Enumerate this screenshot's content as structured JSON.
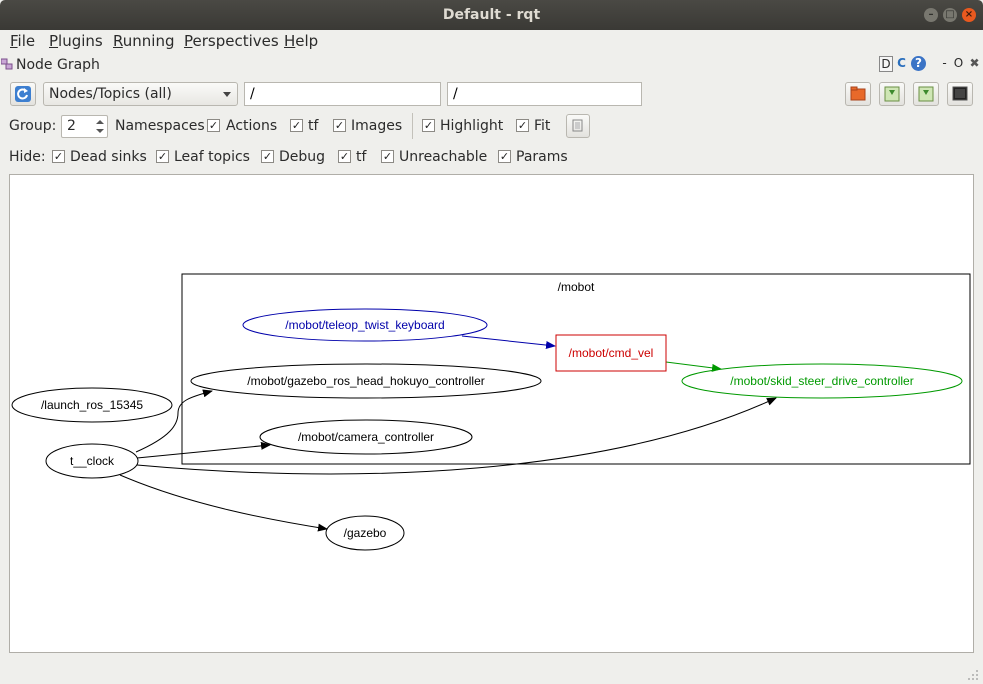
{
  "window": {
    "title": "Default - rqt",
    "minimize": "–",
    "maximize": "□",
    "close": "×"
  },
  "menubar": {
    "items": [
      {
        "mnemonic": "F",
        "rest": "ile"
      },
      {
        "mnemonic": "P",
        "rest": "lugins"
      },
      {
        "mnemonic": "R",
        "rest": "unning"
      },
      {
        "mnemonic": "P",
        "rest": "erspectives"
      },
      {
        "mnemonic": "H",
        "rest": "elp"
      }
    ]
  },
  "plugin": {
    "title": "Node Graph",
    "buttons": {
      "d": "D",
      "reload": "C",
      "help": "?",
      "minimize": "-",
      "float": "O",
      "close": "✖"
    }
  },
  "toolbar": {
    "graph_type": "Nodes/Topics (all)",
    "node_filter": "/",
    "topic_filter": "/"
  },
  "options": {
    "group_label": "Group:",
    "group_value": "2",
    "namespaces": {
      "label": "Namespaces",
      "checked": true
    },
    "actions": {
      "label": "Actions",
      "checked": true
    },
    "tf": {
      "label": "tf",
      "checked": true
    },
    "images": {
      "label": "Images",
      "checked": true
    },
    "highlight": {
      "label": "Highlight",
      "checked": true
    },
    "fit": {
      "label": "Fit",
      "checked": true
    }
  },
  "hide": {
    "label": "Hide:",
    "dead_sinks": {
      "label": "Dead sinks",
      "checked": true
    },
    "leaf_topics": {
      "label": "Leaf topics",
      "checked": true
    },
    "debug": {
      "label": "Debug",
      "checked": true
    },
    "tf": {
      "label": "tf",
      "checked": true
    },
    "unreachable": {
      "label": "Unreachable",
      "checked": true
    },
    "params": {
      "label": "Params",
      "checked": true
    }
  },
  "graph": {
    "namespace_label": "/mobot",
    "nodes": {
      "teleop": "/mobot/teleop_twist_keyboard",
      "cmd_vel": "/mobot/cmd_vel",
      "hokuyo": "/mobot/gazebo_ros_head_hokuyo_controller",
      "skid": "/mobot/skid_steer_drive_controller",
      "launch": "/launch_ros_15345",
      "clock": "t__clock",
      "camera": "/mobot/camera_controller",
      "gazebo": "/gazebo"
    },
    "colors": {
      "teleop": "#0000aa",
      "cmd_vel": "#cc0000",
      "skid": "#009900",
      "default": "#000000"
    }
  }
}
